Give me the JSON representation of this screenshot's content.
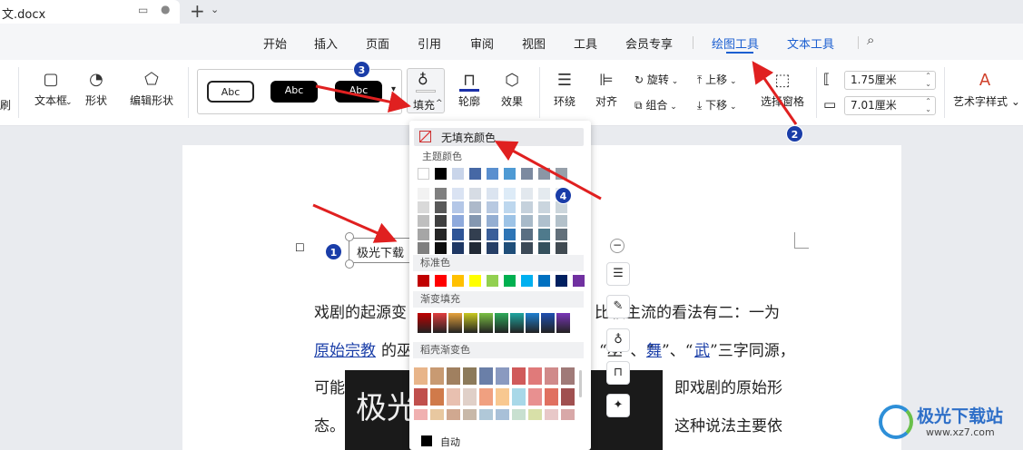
{
  "tab": {
    "title": "文.docx",
    "add": "+"
  },
  "menu": {
    "items": [
      "开始",
      "插入",
      "页面",
      "引用",
      "审阅",
      "视图",
      "工具",
      "会员专享"
    ],
    "active": "绘图工具",
    "text_tools": "文本工具"
  },
  "ribbon": {
    "textbox": "文本框",
    "shape": "形状",
    "edit_shape": "编辑形状",
    "style_abc": "Abc",
    "fill": "填充",
    "outline": "轮廓",
    "effect": "效果",
    "wrap": "环绕",
    "align": "对齐",
    "rotate": "旋转",
    "group": "组合",
    "up": "上移",
    "down": "下移",
    "select_pane": "选择窗格",
    "height": "1.75厘米",
    "width": "7.01厘米",
    "art_style": "艺术字样式"
  },
  "dropdown": {
    "no_fill": "无填充颜色",
    "theme": "主题颜色",
    "standard": "标准色",
    "gradient": "渐变填充",
    "shell_gradient": "稻壳渐变色",
    "auto": "自动"
  },
  "doc": {
    "anchor_text": "极光下载",
    "line1a": "戏剧的起源变",
    "line1b": "比较主流的看法有二：一为",
    "line2a_link": "原始宗教",
    "line2b": "的巫",
    "line2c": "“巫”、“",
    "line2d_link": "舞",
    "line2e": "”、“",
    "line2f_link": "武",
    "line2g": "”三字同源，",
    "line3a": "可能",
    "line3b": "即戏剧的原始形",
    "line4a": "态。",
    "line4b": "这种说法主要依",
    "image_text": "极光"
  },
  "badges": [
    "1",
    "2",
    "3",
    "4"
  ],
  "watermark": {
    "cn": "极光下载站",
    "url": "www.xz7.com"
  },
  "colors": {
    "theme_top": [
      "#ffffff",
      "#000000",
      "#c9d5ea",
      "#4668a5",
      "#5a8fcf",
      "#4e9ad4",
      "#7c8aa0",
      "#8b96a5",
      "#97a0aa"
    ],
    "theme_grid": [
      [
        "#f2f2f2",
        "#7f7f7f",
        "#dae3f3",
        "#d6dce4",
        "#dbe4f0",
        "#ddebf7",
        "#e2e8ee",
        "#e4eaef",
        "#e6ebee"
      ],
      [
        "#d9d9d9",
        "#595959",
        "#b4c7e7",
        "#adb9ca",
        "#b8c9e1",
        "#bdd7ee",
        "#c5d1dc",
        "#cad5de",
        "#ccd6dc"
      ],
      [
        "#bfbfbf",
        "#3f3f3f",
        "#8faadc",
        "#8497b0",
        "#94aed2",
        "#9dc3e6",
        "#a8bac9",
        "#afc0cd",
        "#b3c1ca"
      ],
      [
        "#a6a6a6",
        "#262626",
        "#2f5597",
        "#333f50",
        "#3a5e99",
        "#2e75b6",
        "#5a6f82",
        "#4f7a8c",
        "#62707a"
      ],
      [
        "#7f7f7f",
        "#0d0d0d",
        "#1f3864",
        "#222a35",
        "#263f66",
        "#1f4e79",
        "#3c4a57",
        "#35515d",
        "#414b52"
      ]
    ],
    "standard": [
      "#c00000",
      "#ff0000",
      "#ffc000",
      "#ffff00",
      "#92d050",
      "#00b050",
      "#00b0f0",
      "#0070c0",
      "#002060",
      "#7030a0"
    ],
    "gradient": [
      "#c00000",
      "#e03c3c",
      "#e6a23c",
      "#c8c820",
      "#7bc044",
      "#2eaa5a",
      "#1fa6a0",
      "#1f7fd0",
      "#1f4fb0",
      "#7a36b8"
    ],
    "shell": [
      [
        "#e8b58a",
        "#c89a72",
        "#a08060",
        "#8c7a5a",
        "#6a7fa8",
        "#8a9ac0",
        "#d05a5a",
        "#e07a7a",
        "#d08a8a",
        "#a07a78"
      ],
      [
        "#c0504d",
        "#d07a4a",
        "#e8c0b0",
        "#e0d0c8",
        "#f0a080",
        "#f8c890",
        "#a8d8e8",
        "#e89090",
        "#e07060",
        "#a05050"
      ],
      [
        "#f0b0b0",
        "#e8c8a0",
        "#d0a890",
        "#c8b8a8",
        "#b0c8d8",
        "#a8c0d8",
        "#c8e0d0",
        "#d8e0a8",
        "#e8c8c8",
        "#d8a8a8"
      ]
    ]
  }
}
